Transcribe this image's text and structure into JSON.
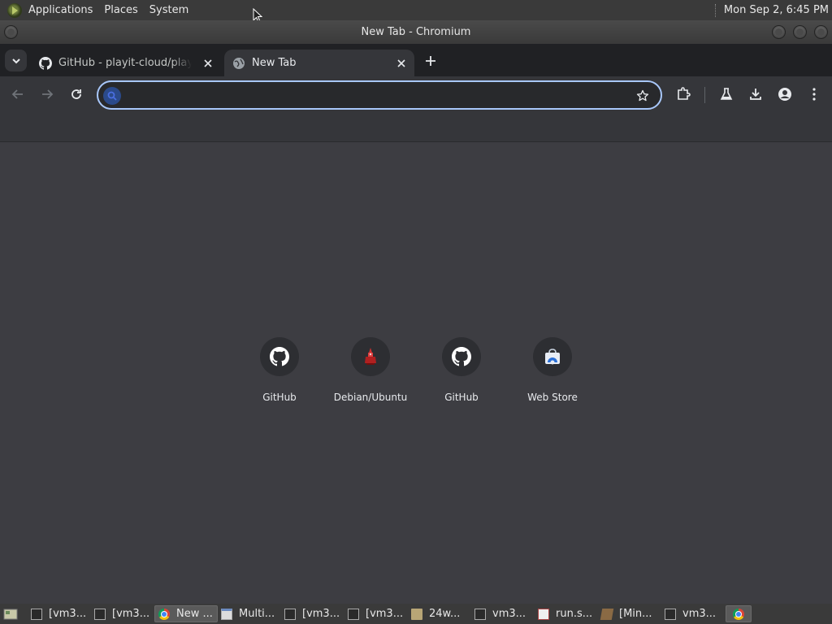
{
  "top_panel": {
    "menus": [
      "Applications",
      "Places",
      "System"
    ],
    "clock": "Mon Sep  2,  6:45 PM"
  },
  "window": {
    "title": "New Tab - Chromium"
  },
  "tabs": [
    {
      "title": "GitHub - playit-cloud/playit-agent",
      "icon": "github-icon",
      "active": false
    },
    {
      "title": "New Tab",
      "icon": "globe-icon",
      "active": true
    }
  ],
  "omnibox": {
    "value": "",
    "placeholder": ""
  },
  "shortcuts": [
    {
      "label": "GitHub",
      "icon": "github-icon"
    },
    {
      "label": "Debian/Ubuntu",
      "icon": "debian-ubuntu-icon"
    },
    {
      "label": "GitHub",
      "icon": "github-icon"
    },
    {
      "label": "Web Store",
      "icon": "web-store-icon"
    }
  ],
  "taskbar": [
    {
      "label": "[vm3...",
      "icon": "terminal-icon"
    },
    {
      "label": "[vm3...",
      "icon": "terminal-icon"
    },
    {
      "label": "New ...",
      "icon": "chromium-icon",
      "active": true
    },
    {
      "label": "Multi...",
      "icon": "window-icon"
    },
    {
      "label": "[vm3...",
      "icon": "terminal-icon"
    },
    {
      "label": "[vm3...",
      "icon": "terminal-icon"
    },
    {
      "label": "24w...",
      "icon": "folder-icon"
    },
    {
      "label": "vm3...",
      "icon": "terminal-icon"
    },
    {
      "label": "run.s...",
      "icon": "text-editor-icon"
    },
    {
      "label": "[Min...",
      "icon": "minecraft-icon"
    },
    {
      "label": "vm3...",
      "icon": "terminal-icon"
    },
    {
      "label": "",
      "icon": "chromium-icon"
    }
  ],
  "colors": {
    "tabstrip": "#202124",
    "toolbar": "#35363a",
    "content": "#3d3d42",
    "omnibox_focus": "#a8c7fa"
  }
}
